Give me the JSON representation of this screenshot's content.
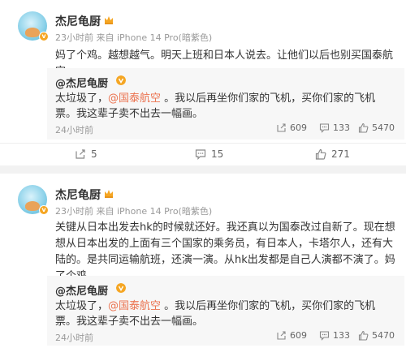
{
  "posts": [
    {
      "author": "杰尼龟厨",
      "meta": "23小时前 来自 iPhone 14 Pro(暗紫色)",
      "text": "妈了个鸡。越想越气。明天上班和日本人说去。让他们以后也别买国泰航空。",
      "quote": {
        "author": "@杰尼龟厨",
        "text_before": "太垃圾了，",
        "mention": "@国泰航空",
        "text_after": " 。我以后再坐你们家的飞机，买你们家的飞机票。我这辈子卖不出去一幅画。",
        "time": "24小时前",
        "shares": "609",
        "comments": "133",
        "likes": "5470"
      },
      "actions": {
        "shares": "5",
        "comments": "15",
        "likes": "271"
      }
    },
    {
      "author": "杰尼龟厨",
      "meta": "23小时前 来自 iPhone 14 Pro(暗紫色)",
      "text": "关键从日本出发去hk的时候就还好。我还真以为国泰改过自新了。现在想想从日本出发的上面有三个国家的乘务员，有日本人，卡塔尔人，还有大陆的。是共同运输航班，还演一演。从hk出发都是自己人演都不演了。妈了个鸡。",
      "quote": {
        "author": "@杰尼龟厨",
        "text_before": "太垃圾了，",
        "mention": "@国泰航空",
        "text_after": " 。我以后再坐你们家的飞机，买你们家的飞机票。我这辈子卖不出去一幅画。",
        "time": "24小时前",
        "shares": "609",
        "comments": "133",
        "likes": "5470"
      }
    }
  ],
  "colors": {
    "mention": "#eb7350",
    "badge": "#f5a623"
  },
  "icons": {
    "share": "share-icon",
    "comment": "comment-icon",
    "like": "thumb-up-icon",
    "verified": "verified-badge-icon",
    "crown": "crown-icon"
  }
}
